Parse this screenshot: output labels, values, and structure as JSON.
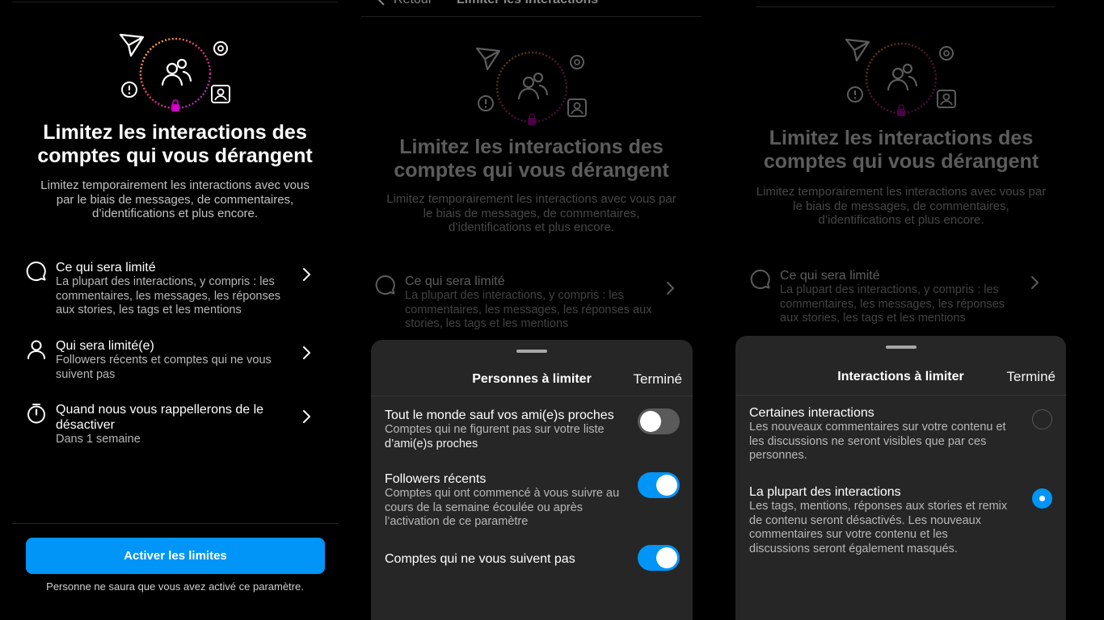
{
  "colors": {
    "accent": "#0095f6",
    "sheet_bg": "#262626",
    "background": "#000000"
  },
  "intro": {
    "title_line1": "Limitez les interactions des",
    "title_line2": "comptes qui vous dérangent",
    "subtitle": "Limitez temporairement les interactions avec vous par le biais de messages, de commentaires, d’identifications et plus encore.",
    "hero_icons": [
      "send-icon",
      "mention-icon",
      "people-icon",
      "alert-bubble-icon",
      "tag-person-icon"
    ],
    "rows": [
      {
        "icon": "comment-icon",
        "title": "Ce qui sera limité",
        "sub": "La plupart des interactions, y compris : les commentaires, les messages, les réponses aux stories, les tags et les mentions"
      },
      {
        "icon": "person-icon",
        "title": "Qui sera limité(e)",
        "sub": "Followers récents et comptes qui ne vous suivent pas"
      },
      {
        "icon": "timer-icon",
        "title": "Quand nous vous rappellerons de le désactiver",
        "sub": "Dans 1 semaine"
      }
    ],
    "cta": "Activer les limites",
    "footnote": "Personne ne saura que vous avez activé ce paramètre."
  },
  "nav": {
    "back_label": "Retour",
    "title": "Limiter les interactions"
  },
  "people_sheet": {
    "title": "Personnes à limiter",
    "done": "Terminé",
    "options": [
      {
        "title": "Tout le monde sauf vos ami(e)s proches",
        "sub": "Comptes qui ne figurent pas sur votre liste",
        "sub_highlight": "d’ami(e)s proches",
        "enabled": false
      },
      {
        "title": "Followers récents",
        "sub": "Comptes qui ont commencé à vous suivre au cours de la semaine écoulée ou après l’activation de ce paramètre",
        "enabled": true
      },
      {
        "title": "Comptes qui ne vous suivent pas",
        "enabled": true
      }
    ]
  },
  "interactions_sheet": {
    "title": "Interactions à limiter",
    "done": "Terminé",
    "options": [
      {
        "title": "Certaines interactions",
        "sub": "Les nouveaux commentaires sur votre contenu et les discussions ne seront visibles que par ces personnes.",
        "selected": false
      },
      {
        "title": "La plupart des interactions",
        "sub": "Les tags, mentions, réponses aux stories et remix de contenu seront désactivés. Les nouveaux commentaires sur votre contenu et les discussions seront également masqués.",
        "selected": true
      }
    ]
  }
}
